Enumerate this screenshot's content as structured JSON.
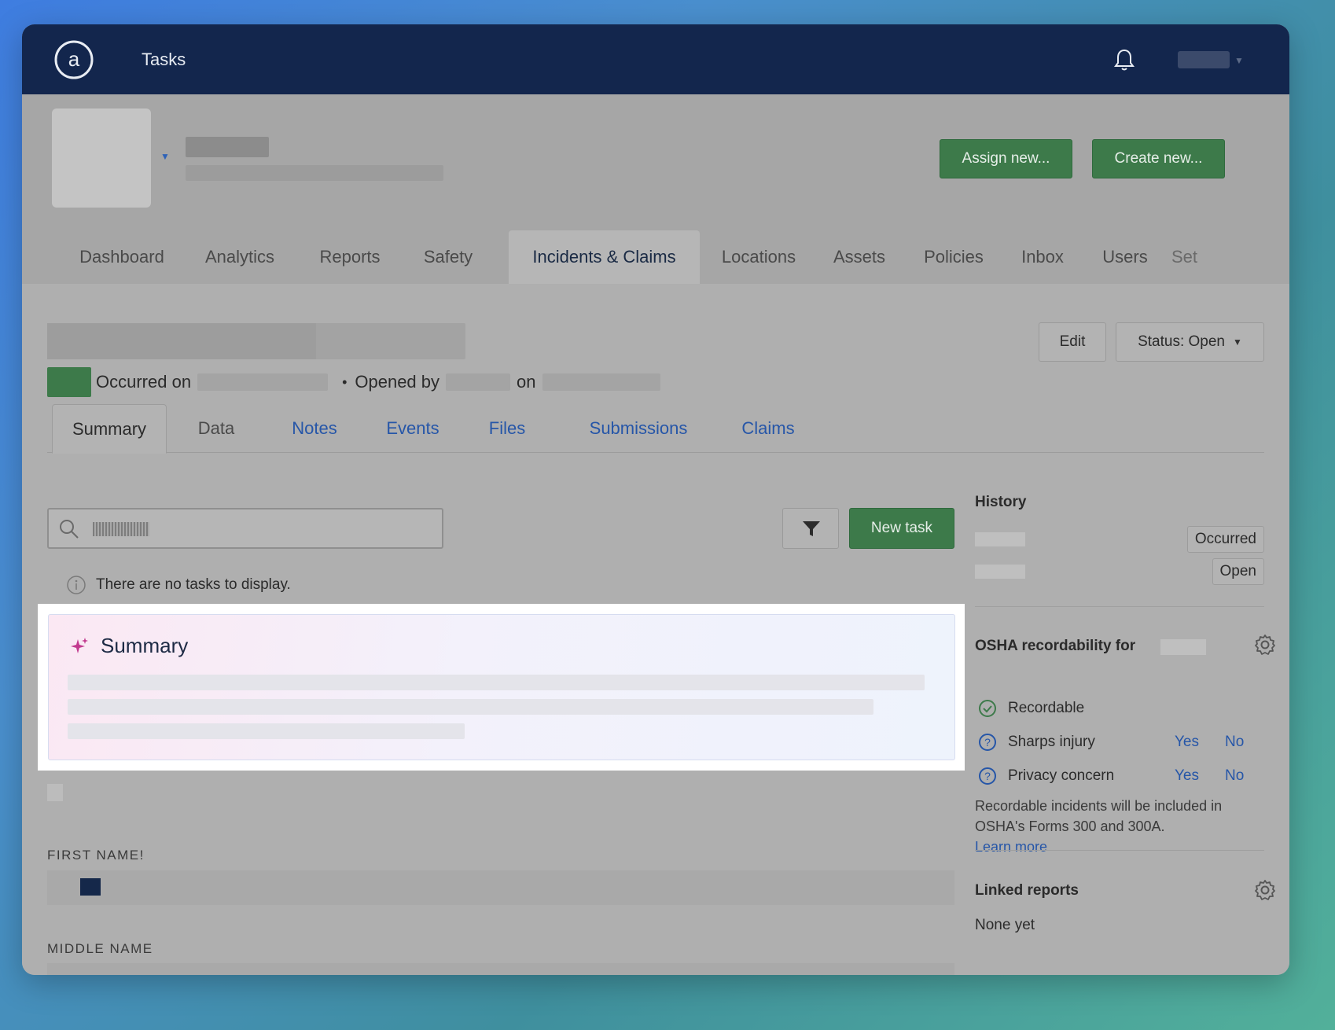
{
  "topbar": {
    "app_title": "Tasks"
  },
  "org_header": {
    "assign_label": "Assign new...",
    "create_label": "Create new..."
  },
  "main_nav": {
    "tabs": [
      {
        "label": "Dashboard"
      },
      {
        "label": "Analytics"
      },
      {
        "label": "Reports"
      },
      {
        "label": "Safety"
      },
      {
        "label": "Incidents & Claims",
        "active": true
      },
      {
        "label": "Locations"
      },
      {
        "label": "Assets"
      },
      {
        "label": "Policies"
      },
      {
        "label": "Inbox"
      },
      {
        "label": "Users"
      },
      {
        "label": "Set"
      }
    ]
  },
  "record": {
    "edit_label": "Edit",
    "status_label": "Status: Open",
    "occurred_on_label": "Occurred on",
    "opened_by_label": "Opened by",
    "on_label": "on",
    "separator": "•"
  },
  "sub_tabs": [
    {
      "label": "Summary",
      "active": true
    },
    {
      "label": "Data"
    },
    {
      "label": "Notes"
    },
    {
      "label": "Events"
    },
    {
      "label": "Files"
    },
    {
      "label": "Submissions"
    },
    {
      "label": "Claims"
    }
  ],
  "tasks": {
    "new_task_label": "New task",
    "empty_message": "There are no tasks to display."
  },
  "summary": {
    "title": "Summary"
  },
  "fields": {
    "first_name_label": "FIRST NAME!",
    "middle_name_label": "MIDDLE NAME"
  },
  "history": {
    "heading": "History",
    "entries": [
      {
        "tag": "Occurred"
      },
      {
        "tag": "Open"
      }
    ]
  },
  "osha": {
    "heading": "OSHA recordability for",
    "recordable_label": "Recordable",
    "rows": [
      {
        "label": "Sharps injury",
        "yes": "Yes",
        "no": "No"
      },
      {
        "label": "Privacy concern",
        "yes": "Yes",
        "no": "No"
      }
    ],
    "note": "Recordable incidents will be included in OSHA's Forms 300 and 300A.",
    "learn_more": "Learn more"
  },
  "linked_reports": {
    "heading": "Linked reports",
    "empty": "None yet"
  },
  "colors": {
    "topbar": "#13264d",
    "green_button": "#3d7a4a",
    "link_blue": "#2656a8"
  }
}
